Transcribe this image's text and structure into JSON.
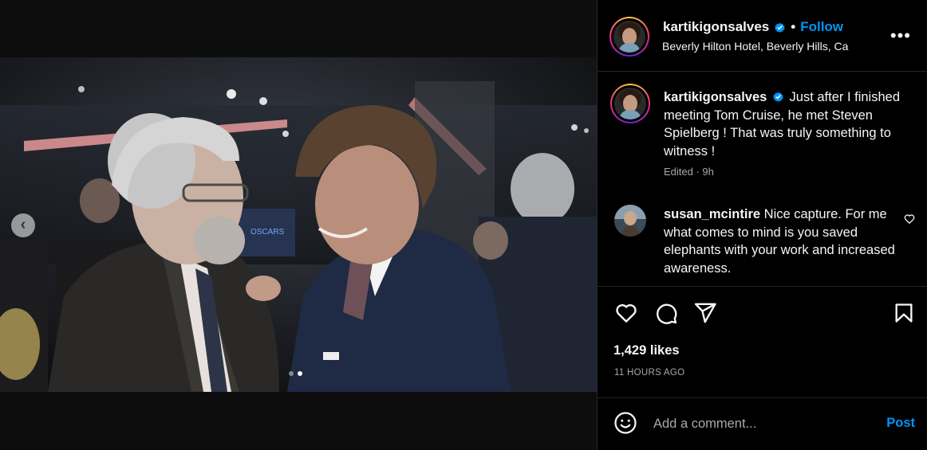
{
  "post": {
    "username": "kartikigonsalves",
    "follow_label": "Follow",
    "separator": "•",
    "location": "Beverly Hilton Hotel, Beverly Hills, Ca",
    "more_label": "•••"
  },
  "caption": {
    "username": "kartikigonsalves",
    "text": "Just after I finished meeting Tom Cruise, he met Steven Spielberg ! That was truly something to witness !",
    "meta": "Edited · 9h"
  },
  "comment": {
    "username": "susan_mcintire",
    "text": "Nice capture. For me what comes to mind is you saved elephants with your work and increased awareness."
  },
  "stats": {
    "likes": "1,429 likes",
    "time": "11 HOURS AGO"
  },
  "compose": {
    "placeholder": "Add a comment...",
    "post_label": "Post"
  },
  "carousel": {
    "prev_glyph": "‹",
    "slide_count": 2,
    "active_slide": 2
  },
  "icons": {
    "verified": "verified-badge-icon",
    "like": "heart-icon",
    "comment": "comment-icon",
    "share": "share-icon",
    "save": "bookmark-icon",
    "emoji": "emoji-icon",
    "more": "more-options-icon"
  },
  "colors": {
    "accent": "#0095f6",
    "background": "#000000",
    "muted": "#a8a8a8",
    "divider": "#262626"
  }
}
